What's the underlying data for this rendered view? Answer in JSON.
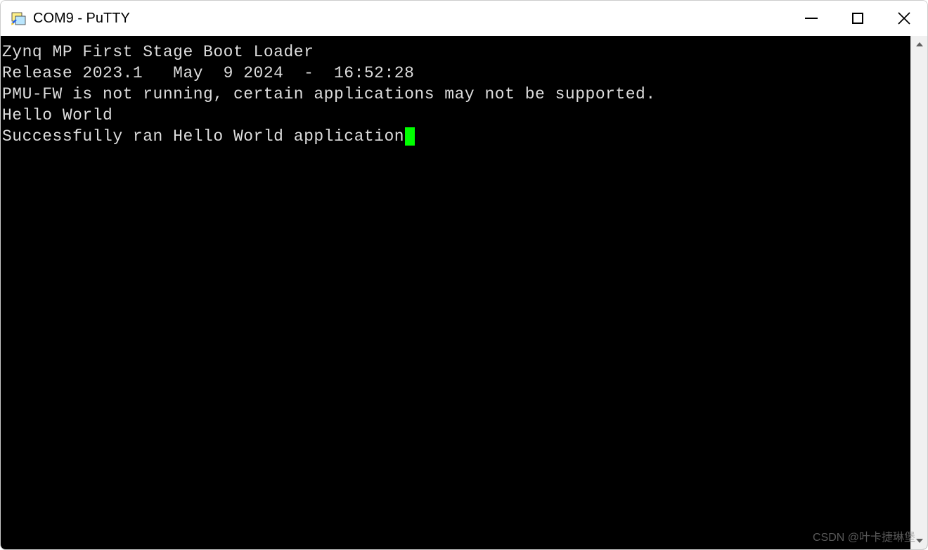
{
  "window": {
    "title": "COM9 - PuTTY"
  },
  "terminal": {
    "lines": [
      "Zynq MP First Stage Boot Loader",
      "Release 2023.1   May  9 2024  -  16:52:28",
      "PMU-FW is not running, certain applications may not be supported.",
      "Hello World",
      "Successfully ran Hello World application"
    ]
  },
  "watermark": "CSDN @叶卡捷琳堡",
  "colors": {
    "terminal_bg": "#000000",
    "terminal_fg": "#dddddd",
    "cursor": "#00ff00",
    "titlebar_bg": "#ffffff"
  }
}
